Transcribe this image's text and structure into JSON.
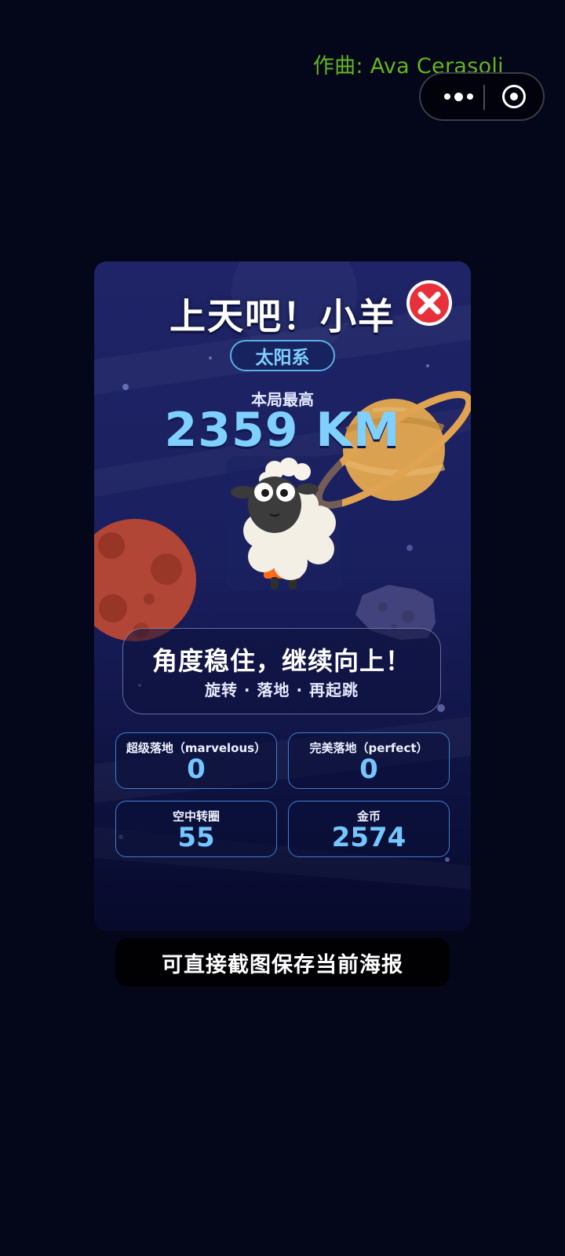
{
  "credit": {
    "text": "作曲: Ava Cerasoli"
  },
  "capsule": {
    "more_icon": "more-dots-icon",
    "target_icon": "target-circle-icon"
  },
  "poster": {
    "title": "上天吧！小羊",
    "close_icon": "close-x-icon",
    "system": "太阳系",
    "best_label": "本局最高",
    "best_value": "2359 KM",
    "tip_main": "角度稳住，继续向上！",
    "tip_sub": "旋转 · 落地 · 再起跳",
    "stats": [
      {
        "label": "超级落地（marvelous）",
        "value": "0"
      },
      {
        "label": "完美落地（perfect）",
        "value": "0"
      },
      {
        "label": "空中转圈",
        "value": "55"
      },
      {
        "label": "金币",
        "value": "2574"
      }
    ]
  },
  "footer": {
    "save_hint": "可直接截图保存当前海报"
  },
  "colors": {
    "background": "#04061a",
    "credit": "#63b51e",
    "accent_blue": "#7fd0ff",
    "close_red": "#e8303a"
  }
}
